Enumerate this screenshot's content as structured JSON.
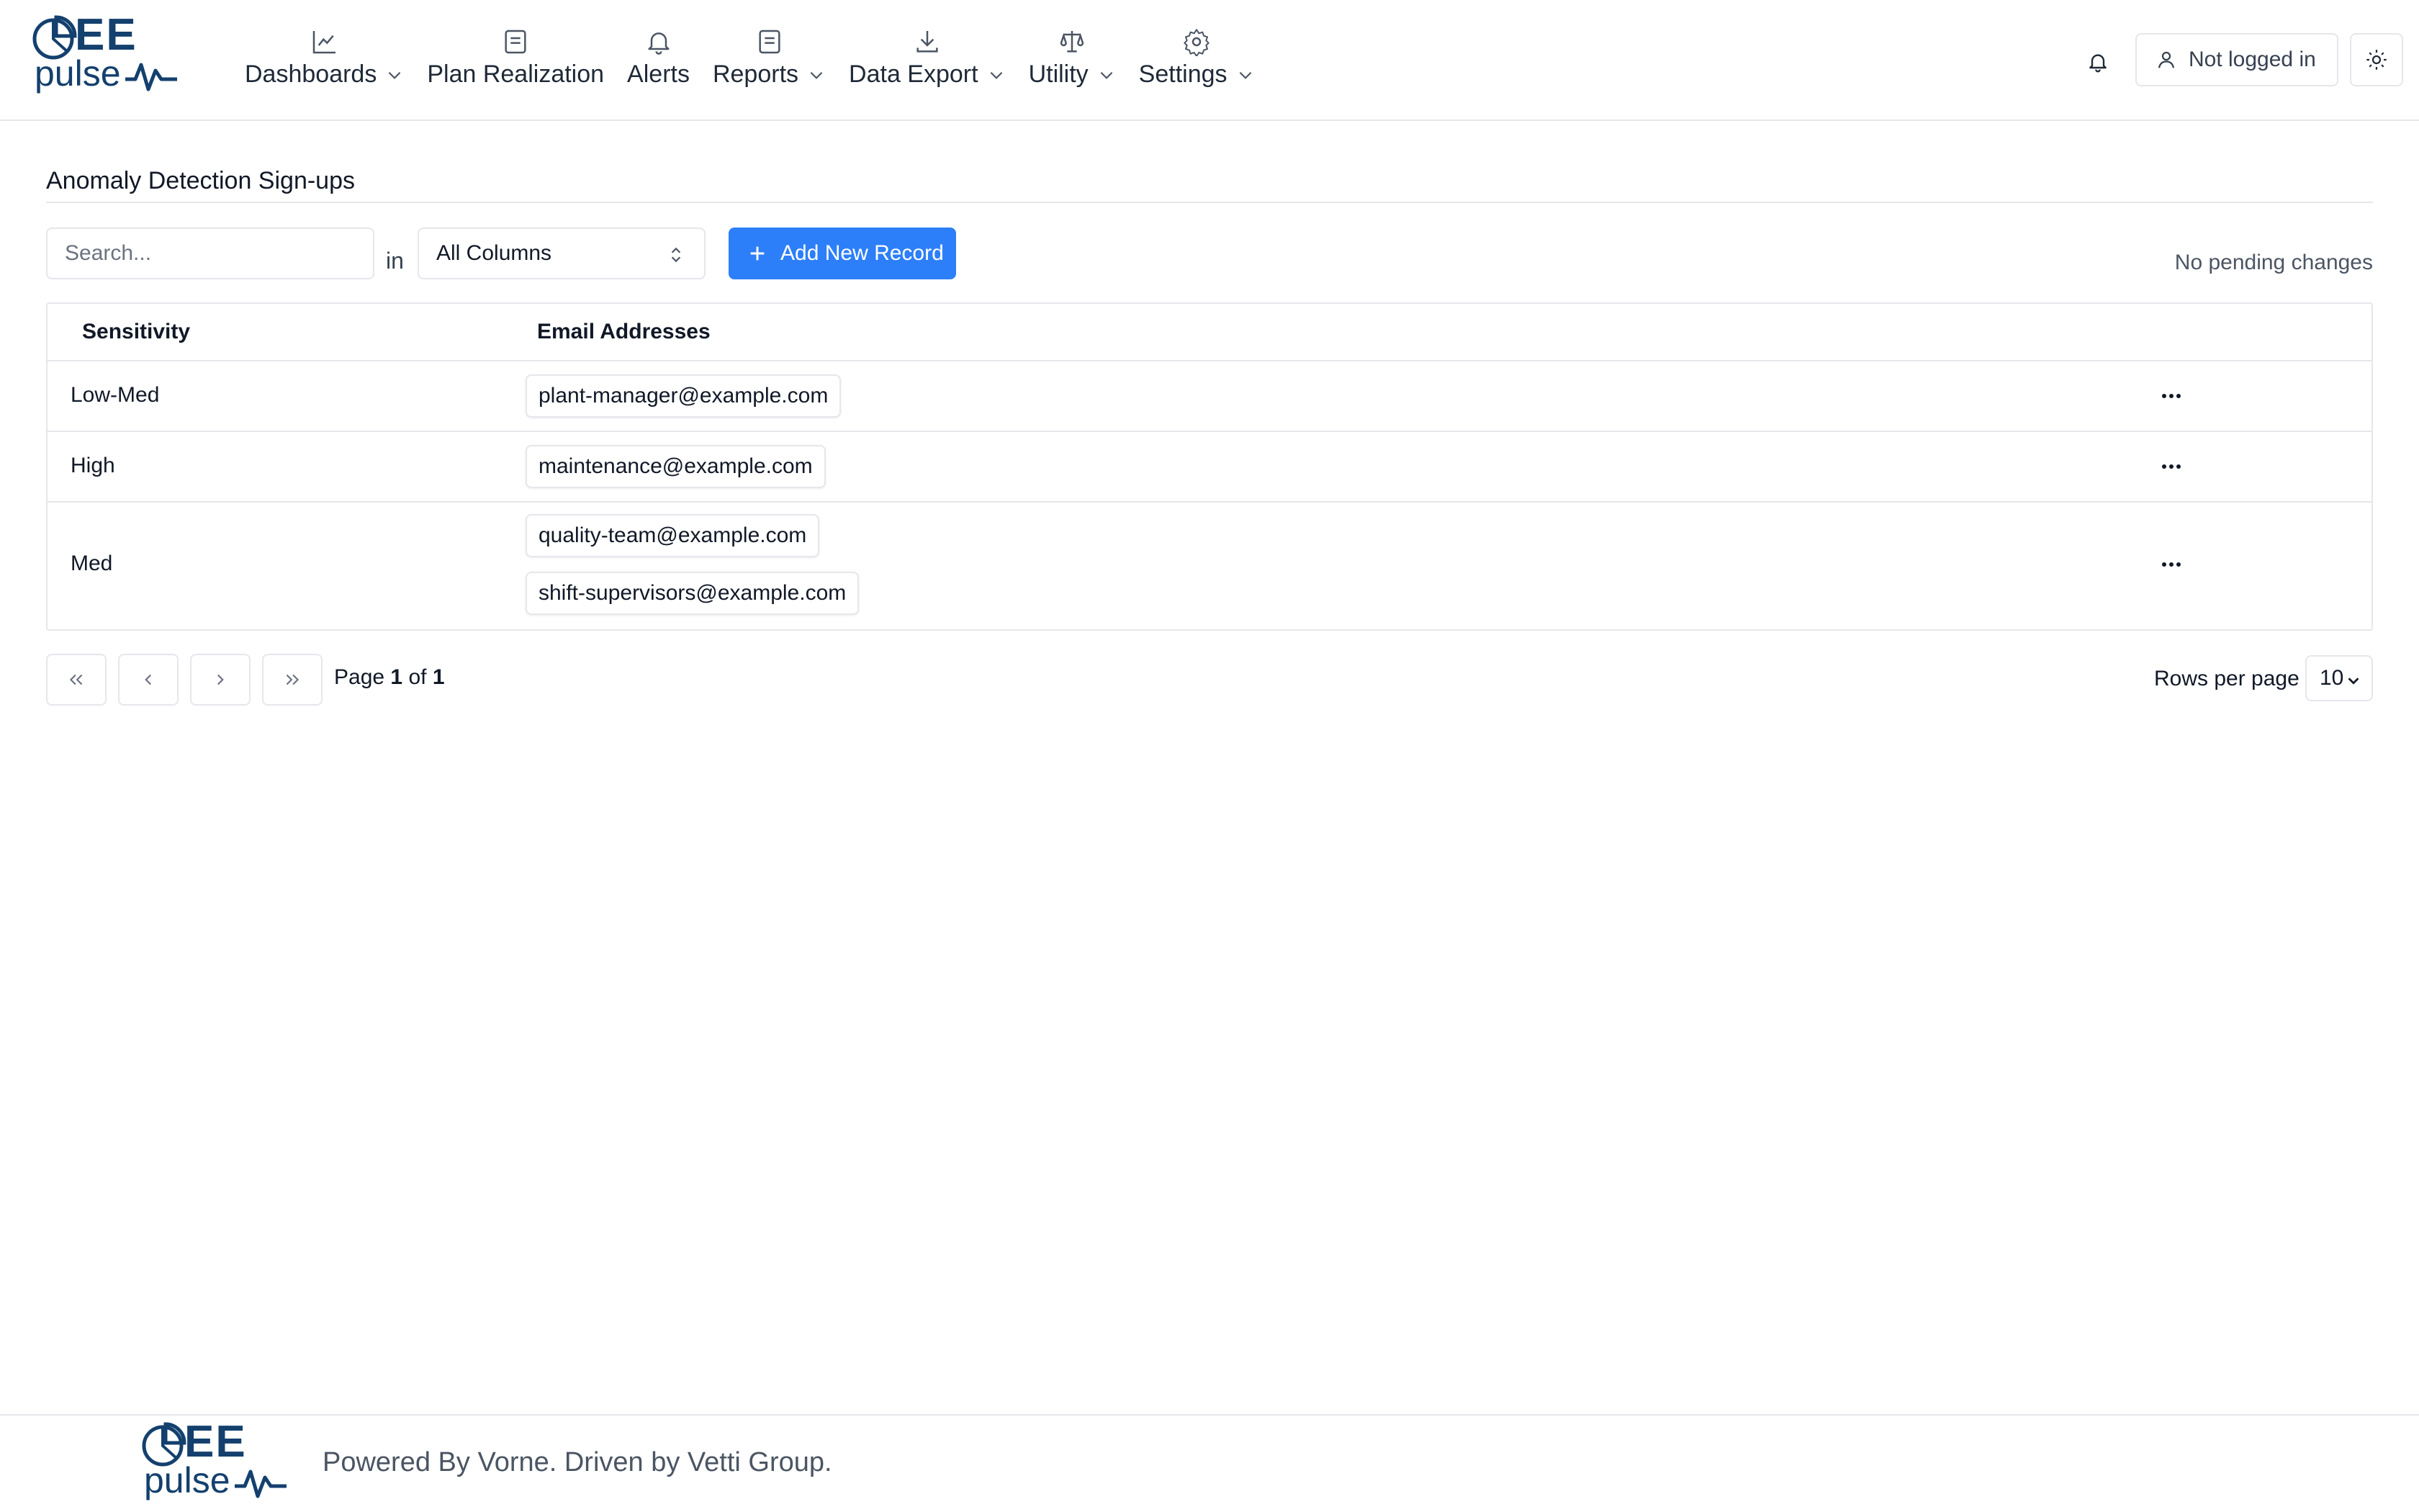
{
  "brand": {
    "logo_top": "EE",
    "logo_bottom": "pulse",
    "color": "#14406e"
  },
  "nav": {
    "items": [
      {
        "label": "Dashboards",
        "icon": "line-chart-icon",
        "has_dropdown": true
      },
      {
        "label": "Plan Realization",
        "icon": "document-icon",
        "has_dropdown": false
      },
      {
        "label": "Alerts",
        "icon": "bell-icon",
        "has_dropdown": false
      },
      {
        "label": "Reports",
        "icon": "document-icon",
        "has_dropdown": true
      },
      {
        "label": "Data Export",
        "icon": "download-icon",
        "has_dropdown": true
      },
      {
        "label": "Utility",
        "icon": "scale-icon",
        "has_dropdown": true
      },
      {
        "label": "Settings",
        "icon": "gear-icon",
        "has_dropdown": true
      }
    ]
  },
  "header_actions": {
    "notifications_icon": "bell-icon",
    "login_label": "Not logged in",
    "user_icon": "user-icon",
    "theme_icon": "sun-icon"
  },
  "main": {
    "title": "Anomaly Detection Sign-ups",
    "toolbar": {
      "search_placeholder": "Search...",
      "in_label": "in",
      "column_filter": "All Columns",
      "add_label": "Add New Record",
      "pending_status": "No pending changes",
      "accent": "#2d7ff9"
    },
    "table": {
      "columns": [
        "Sensitivity",
        "Email Addresses"
      ],
      "rows": [
        {
          "sensitivity": "Low-Med",
          "emails": [
            "plant-manager@example.com"
          ]
        },
        {
          "sensitivity": "High",
          "emails": [
            "maintenance@example.com"
          ]
        },
        {
          "sensitivity": "Med",
          "emails": [
            "quality-team@example.com",
            "shift-supervisors@example.com"
          ]
        }
      ],
      "row_menu_icon": "more-horizontal-icon"
    },
    "pagination": {
      "page_prefix": "Page",
      "current_page": "1",
      "of_label": "of",
      "total_pages": "1",
      "rows_per_page_label": "Rows per page",
      "rows_per_page": "10"
    }
  },
  "footer": {
    "text": "Powered By Vorne. Driven by Vetti Group."
  }
}
